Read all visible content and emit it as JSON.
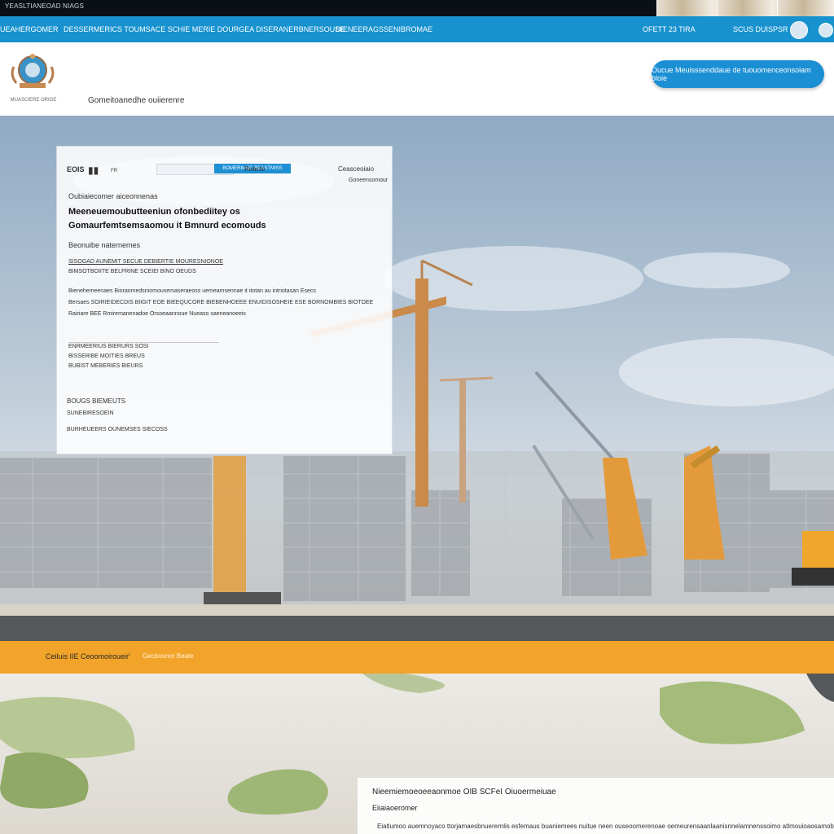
{
  "topbar": {
    "label": "YEASLTIANEOAD NIAGS"
  },
  "navbar": {
    "links": [
      "UEAHERGOMER",
      "DESSERMERICS TOUMSACE SCHIE MERIE DOURGEA DISERANERBNERSOUSE",
      "DIENEERAGSSENIBROMAE",
      "OFETT 23 TIRA",
      "SCUS DUISPSR"
    ]
  },
  "header": {
    "seal_caption": "MUASCIERE ORIGE",
    "breadcrumb": "Gomeitoanedhe ouiierenre",
    "cta": "Oucue Meuisssenddaue de tuouomenceonsoiam bloie"
  },
  "panel": {
    "tab_left": "EOIS",
    "tab_mid": "FR",
    "tab_btn": "BOMERIMOE BEASTMISS",
    "tab_right": "Reacte",
    "right_meta": "Ceasceoiaio",
    "right_meta2": "Goneensomour",
    "kicker": "Oubiaiecomer aiceonnenas",
    "headline_line1": "Meeneuemoubutteeniun ofonbediitey os",
    "headline_line2": "Gomaurfemtsemsaomou it Bmnurd ecomouds",
    "subhead": "Beonuibe naternemes",
    "lines": [
      "SISOGAD AUNEMIT SECUE DEBIERTIE MOURESNIONOE",
      "BIMSOTBOIITE BELFRINE SCEIEI BINO OEUDS",
      "Bienehemeenaes  Bioraomedsniomousemaseraeoss uemeamsennae it itotan au intriotasan  Esecs",
      "Bersaes   SOIRIEIDECDIS   BIIGIT   EOE   BIEEQUCORE   BIEBENHOEEE ENUIDISOSHEIE   ESE BORNOMBIES   BIOTOEE",
      "Rairiare BEE  Rmiremanenadoe  Orsoeaannoue  Nueaso  saeneanoeeis"
    ],
    "list": [
      "ENRMEERIUS BIERURS SOSI",
      "BISSERIBE MOITIES BREUS",
      "BUBIST MEBERIES BIEURS"
    ],
    "footer1": "BOUGS BIEMEUTS",
    "footer2": "SUNEBIRESOEIN",
    "footer3": "BURHEUEERS OUNEMSES SIECOSS"
  },
  "band": {
    "left": "Ceiluis IIE Ceoomoiroueir'",
    "right": "Gecbounnr Beate"
  },
  "info_card": {
    "title": "Nieemiemoeoeeaonmoe  OIB  SCFeI Oiuoermeiuae",
    "subtitle": "Eiiaiaoeromer",
    "body": "Eiatlumoo auemnoyaco  ttorjamaesbnuerernlis esfemaus  buaniemees nuitue  neen ouseoomerenoae oemeurensaanlaanisnnelamnenssoimo atlmouioaosamobiise"
  },
  "icons": {
    "seal": "coat-of-arms-icon",
    "nav_circle_1": "user-icon",
    "nav_circle_2": "menu-icon"
  },
  "colors": {
    "nav_blue": "#1792cf",
    "band_orange": "#f2a329",
    "top_black": "#0b0f16",
    "cta_blue": "#1b8fd4"
  }
}
